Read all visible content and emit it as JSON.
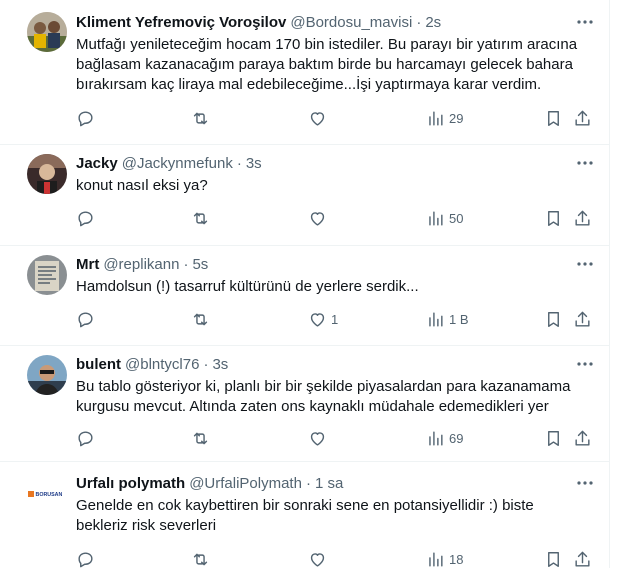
{
  "tweets": [
    {
      "name": "Kliment Yefremoviç Voroşilov",
      "handle": "@Bordosu_mavisi",
      "dot": "·",
      "time": "2s",
      "text": "Mutfağı yenileteceğim hocam 170 bin istediler. Bu parayı bir yatırım aracına bağlasam kazanacağım paraya baktım birde bu harcamayı gelecek bahara bırakırsam kaç liraya mal edebileceğime...İşi yaptırmaya karar verdim.",
      "likes": "",
      "views": "29"
    },
    {
      "name": "Jacky",
      "handle": "@Jackynmefunk",
      "dot": "·",
      "time": "3s",
      "text": "konut nasıl eksi ya?",
      "likes": "",
      "views": "50"
    },
    {
      "name": "Mrt",
      "handle": "@replikann",
      "dot": "·",
      "time": "5s",
      "text": "Hamdolsun (!) tasarruf kültürünü de yerlere serdik...",
      "likes": "1",
      "views": "1 B"
    },
    {
      "name": "bulent",
      "handle": "@blntycl76",
      "dot": "·",
      "time": "3s",
      "text": "Bu tablo gösteriyor ki, planlı bir bir şekilde piyasalardan para kazanamama kurgusu mevcut. Altında zaten ons kaynaklı müdahale edemedikleri yer",
      "likes": "",
      "views": "69"
    },
    {
      "name": "Urfalı polymath",
      "handle": "@UrfaliPolymath",
      "dot": "·",
      "time": "1 sa",
      "text": "Genelde en cok kaybettiren bir sonraki sene en potansiyellidir :) biste bekleriz risk severleri",
      "likes": "",
      "views": "18",
      "avatar_text": "BORUSAN"
    }
  ],
  "colors": {
    "text": "#0f1419",
    "secondary": "#536471",
    "border": "#eff3f4"
  }
}
